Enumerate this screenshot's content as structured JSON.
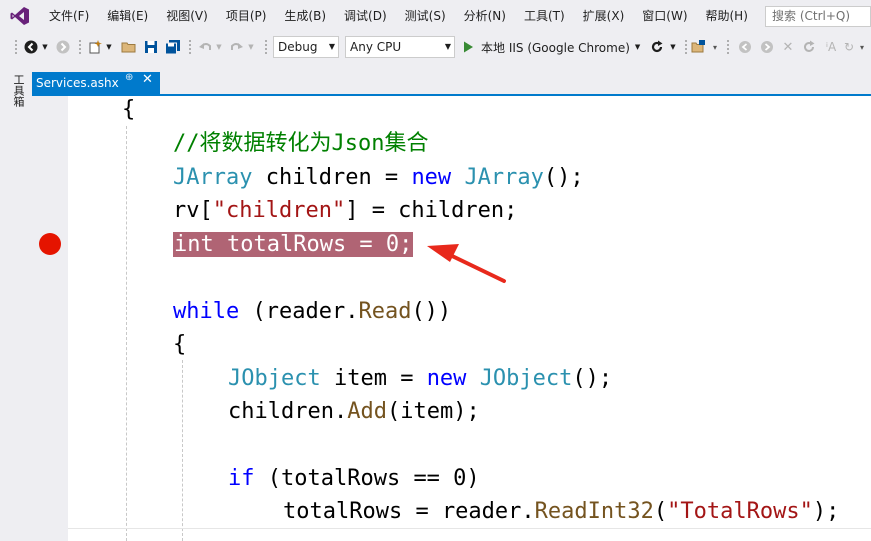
{
  "menubar": {
    "items": [
      "文件(F)",
      "编辑(E)",
      "视图(V)",
      "项目(P)",
      "生成(B)",
      "调试(D)",
      "测试(S)",
      "分析(N)",
      "工具(T)",
      "扩展(X)",
      "窗口(W)",
      "帮助(H)"
    ],
    "search_placeholder": "搜索 (Ctrl+Q)"
  },
  "toolbar": {
    "config": "Debug",
    "platform": "Any CPU",
    "run_label": "本地 IIS (Google Chrome)"
  },
  "toolbox": {
    "label": "工具箱"
  },
  "tab": {
    "title": "Services.ashx",
    "pin": "⊕",
    "close": "✕"
  },
  "code": {
    "l1": "{",
    "l2_comment": "//将数据转化为Json集合",
    "l3_type1": "JArray",
    "l3_mid": " children = ",
    "l3_kw": "new",
    "l3_type2": "JArray",
    "l3_end": "();",
    "l4_a": "rv[",
    "l4_str": "\"children\"",
    "l4_b": "] = children;",
    "l5_highlight": "int totalRows = 0;",
    "l6_kw": "while",
    "l6_a": " (reader.",
    "l6_method": "Read",
    "l6_b": "())",
    "l7": "{",
    "l8_type1": "JObject",
    "l8_mid": " item = ",
    "l8_kw": "new",
    "l8_type2": "JObject",
    "l8_end": "();",
    "l9_a": "children.",
    "l9_method": "Add",
    "l9_b": "(item);",
    "l10_kw": "if",
    "l10_a": " (totalRows == 0)",
    "l11_a": "totalRows = reader.",
    "l11_method": "ReadInt32",
    "l11_b": "(",
    "l11_str": "\"TotalRows\"",
    "l11_c": ");"
  },
  "colors": {
    "accent": "#007acc",
    "breakpoint": "#e51400",
    "highlight": "#b06474",
    "annotation_arrow": "#e8291c"
  }
}
